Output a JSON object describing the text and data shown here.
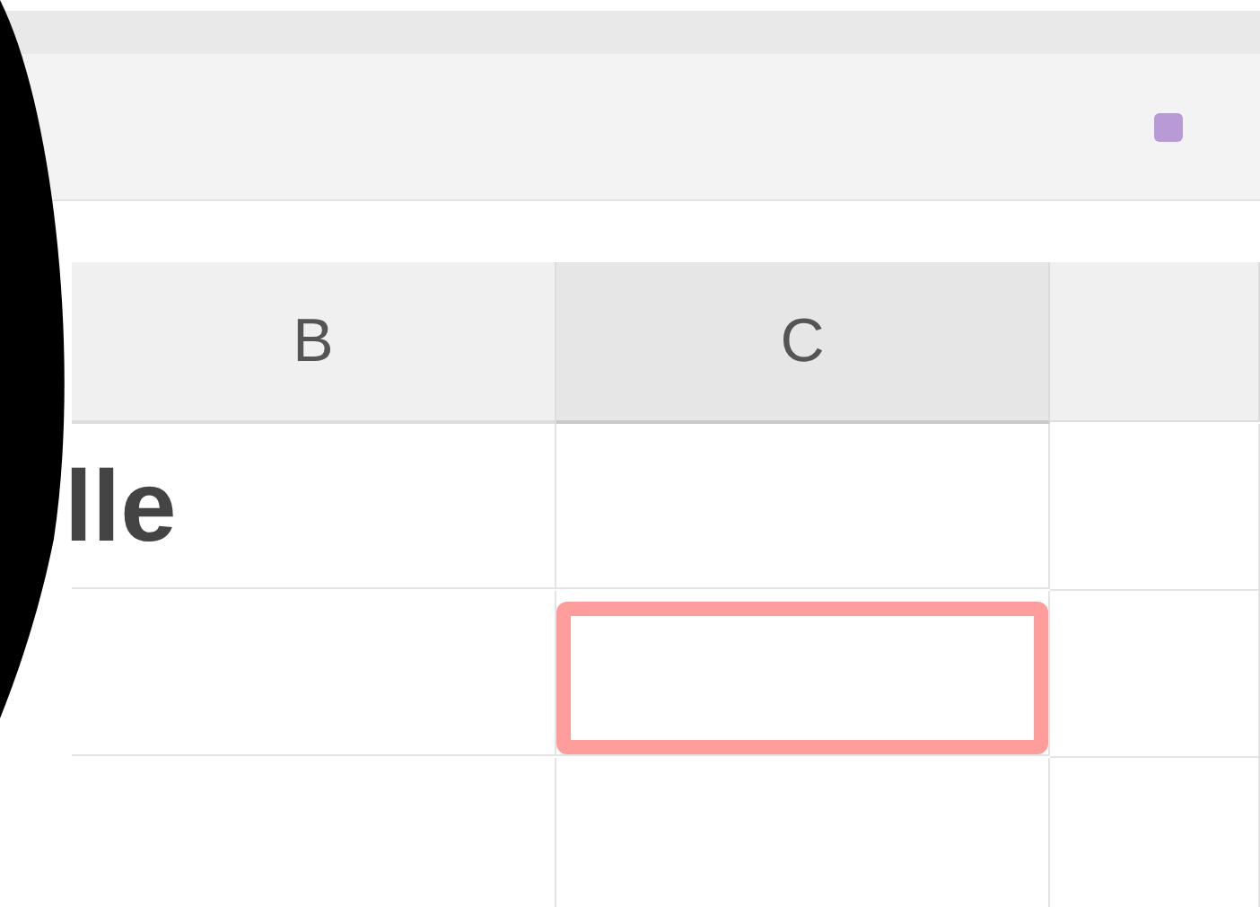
{
  "grid": {
    "columns": [
      {
        "label": "B",
        "selected": false
      },
      {
        "label": "C",
        "selected": true
      }
    ],
    "rows": [
      {
        "cells": [
          {
            "text": "lle",
            "highlighted": false
          },
          {
            "highlighted": false
          }
        ]
      },
      {
        "cells": [
          {
            "highlighted": false
          },
          {
            "highlighted": true
          }
        ]
      },
      {
        "cells": [
          {
            "highlighted": false
          },
          {
            "highlighted": false
          }
        ]
      }
    ]
  }
}
